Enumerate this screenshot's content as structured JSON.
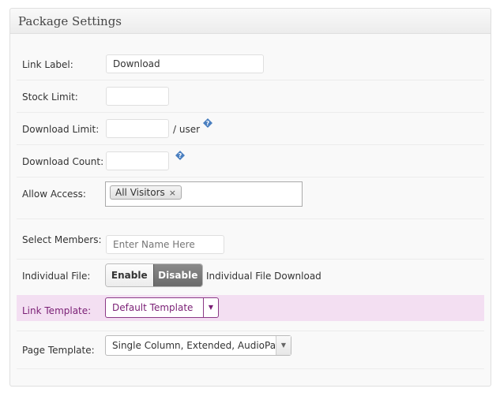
{
  "panel": {
    "title": "Package Settings"
  },
  "fields": {
    "link_label": {
      "label": "Link Label:",
      "value": "Download"
    },
    "stock_limit": {
      "label": "Stock Limit:",
      "value": ""
    },
    "download_limit": {
      "label": "Download Limit:",
      "value": "",
      "suffix": "/ user"
    },
    "download_count": {
      "label": "Download Count:",
      "value": ""
    },
    "allow_access": {
      "label": "Allow Access:",
      "tags": [
        "All Visitors"
      ],
      "remove_glyph": "×"
    },
    "select_members": {
      "label": "Select Members:",
      "placeholder": "Enter Name Here"
    },
    "individual_file": {
      "label": "Individual File:",
      "enable_label": "Enable",
      "disable_label": "Disable",
      "description": "Individual File Download"
    },
    "link_template": {
      "label": "Link Template:",
      "value": "Default Template"
    },
    "page_template": {
      "label": "Page Template:",
      "value": "Single Column, Extended, AudioPa..."
    }
  },
  "colors": {
    "highlight_bg": "#f3dff2",
    "highlight_text": "#7a1f75",
    "help_icon": "#4a7fc0"
  },
  "icons": {
    "help": "help-question-icon",
    "remove": "close-icon",
    "dropdown": "chevron-down-icon"
  }
}
